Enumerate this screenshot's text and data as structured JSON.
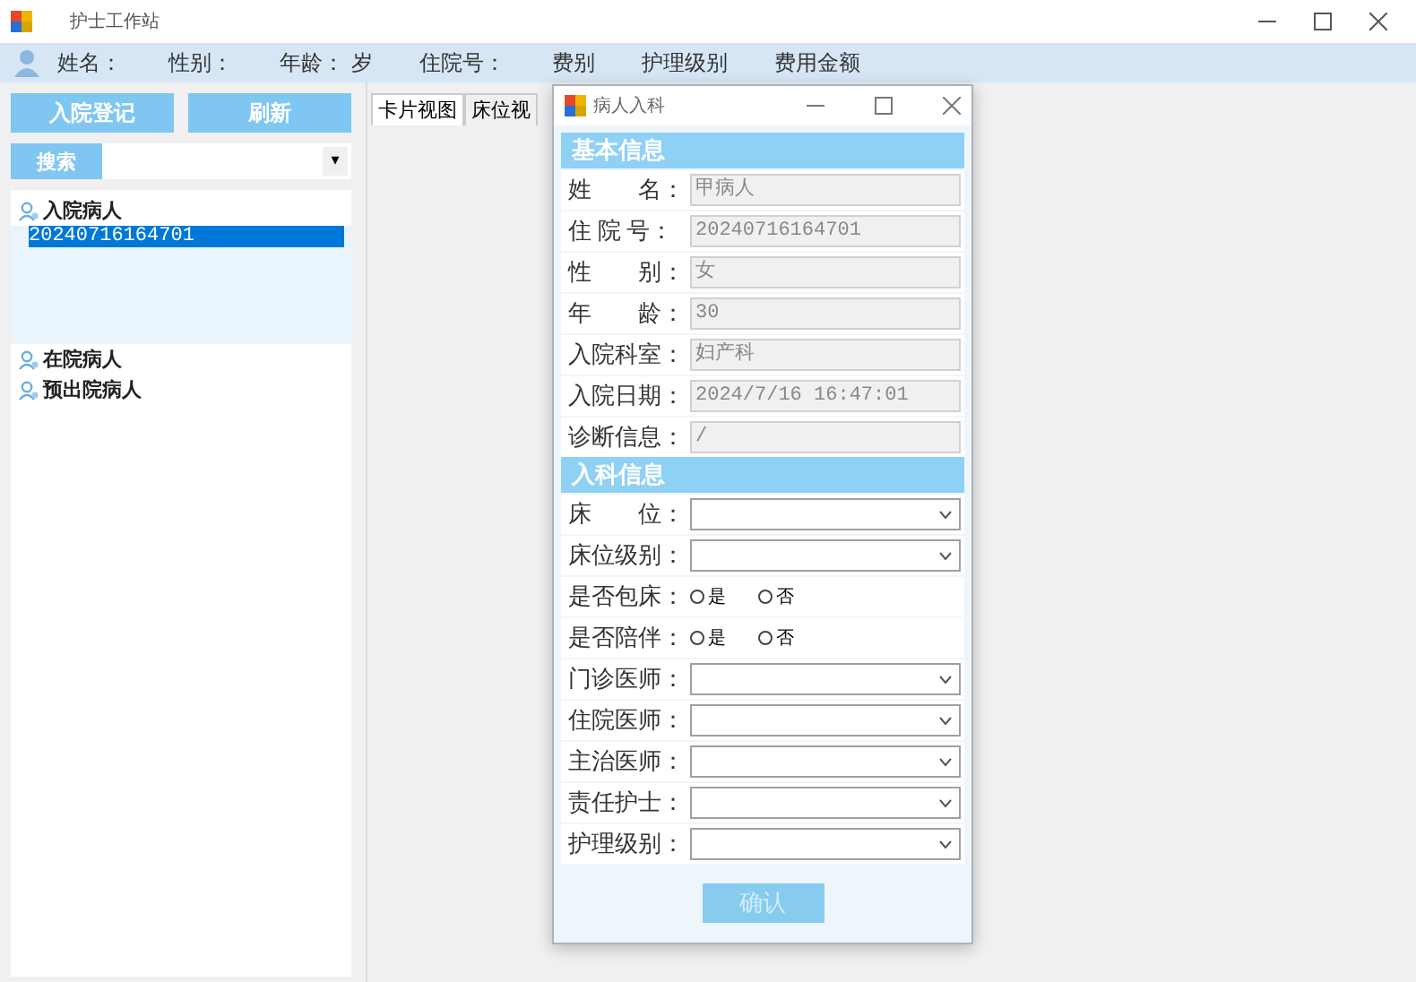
{
  "window": {
    "title": "护士工作站"
  },
  "patient_bar": {
    "labels": [
      "姓名：",
      "性别：",
      "年龄：",
      "岁",
      "住院号：",
      "费别",
      "护理级别",
      "费用金额"
    ]
  },
  "sidebar": {
    "buttons": [
      "入院登记",
      "刷新"
    ],
    "search": {
      "button": "搜索",
      "dropdown": "▾"
    },
    "tree": [
      {
        "label": "入院病人",
        "selected": false,
        "children": [
          {
            "label": "20240716164701",
            "selected": true
          }
        ]
      },
      {
        "label": "在院病人",
        "selected": false
      },
      {
        "label": "预出院病人",
        "selected": false
      }
    ]
  },
  "tabs": [
    {
      "label": "卡片视图",
      "selected": true
    },
    {
      "label": "床位视",
      "selected": false
    }
  ],
  "dialog": {
    "title": "病人入科",
    "sections": [
      {
        "title": "基本信息",
        "rows": [
          {
            "kind": "text",
            "label": "姓　　名：",
            "value": "甲病人"
          },
          {
            "kind": "text",
            "label": "住 院 号：",
            "value": "20240716164701"
          },
          {
            "kind": "text",
            "label": "性　　别：",
            "value": "女"
          },
          {
            "kind": "text",
            "label": "年　　龄：",
            "value": "30"
          },
          {
            "kind": "text",
            "label": "入院科室：",
            "value": "妇产科"
          },
          {
            "kind": "text",
            "label": "入院日期：",
            "value": "2024/7/16 16:47:01"
          },
          {
            "kind": "text",
            "label": "诊断信息：",
            "value": "/"
          }
        ]
      },
      {
        "title": "入科信息",
        "rows": [
          {
            "kind": "combo",
            "label": "床　　位："
          },
          {
            "kind": "combo",
            "label": "床位级别："
          },
          {
            "kind": "radio",
            "label": "是否包床：",
            "options": [
              {
                "label": "是",
                "selected": false
              },
              {
                "label": "否",
                "selected": false
              }
            ]
          },
          {
            "kind": "radio",
            "label": "是否陪伴：",
            "options": [
              {
                "label": "是",
                "selected": false
              },
              {
                "label": "否",
                "selected": false
              }
            ]
          },
          {
            "kind": "combo",
            "label": "门诊医师："
          },
          {
            "kind": "combo",
            "label": "住院医师："
          },
          {
            "kind": "combo",
            "label": "主治医师："
          },
          {
            "kind": "combo",
            "label": "责任护士："
          },
          {
            "kind": "combo",
            "label": "护理级别："
          }
        ]
      }
    ],
    "confirm": {
      "label": "确认",
      "disabled": true
    }
  }
}
